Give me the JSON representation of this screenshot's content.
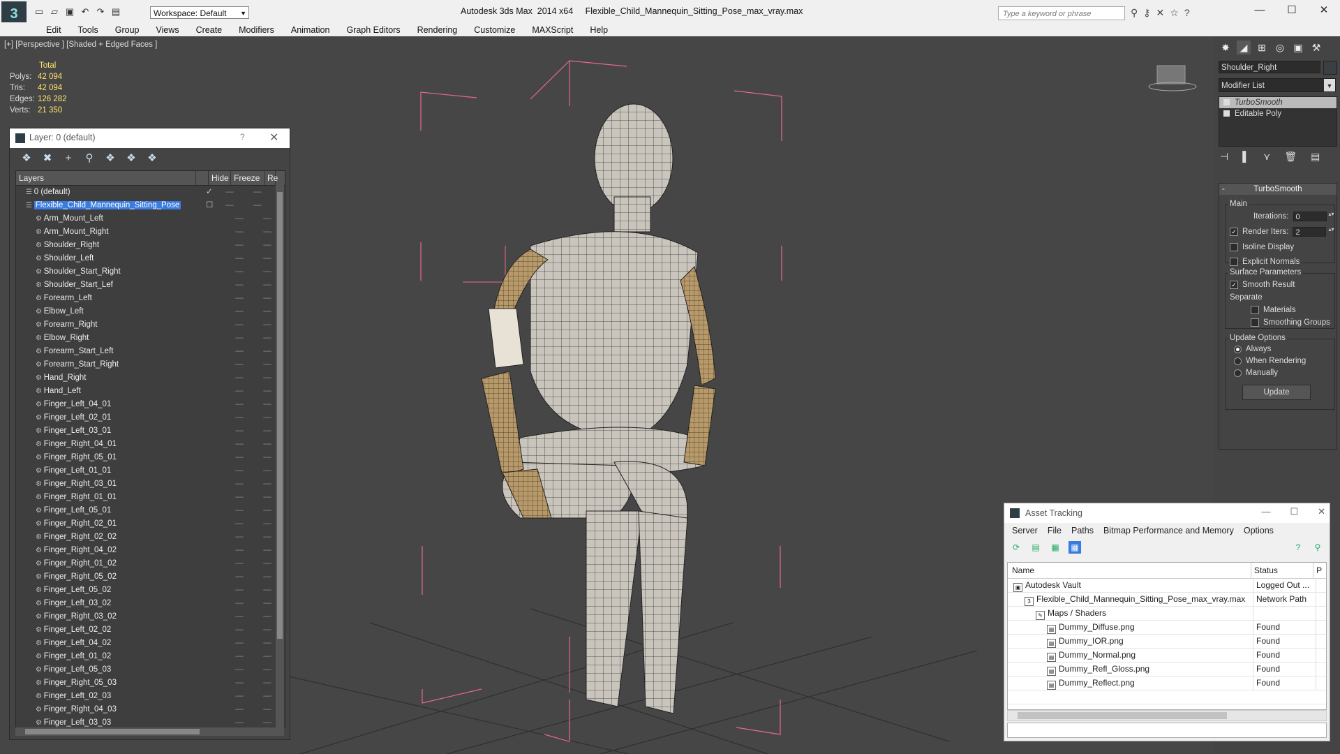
{
  "titlebar": {
    "app_title": "Autodesk 3ds Max  2014 x64     Flexible_Child_Mannequin_Sitting_Pose_max_vray.max",
    "workspace": "Workspace: Default",
    "search_placeholder": "Type a keyword or phrase"
  },
  "menu": [
    "Edit",
    "Tools",
    "Group",
    "Views",
    "Create",
    "Modifiers",
    "Animation",
    "Graph Editors",
    "Rendering",
    "Customize",
    "MAXScript",
    "Help"
  ],
  "viewport": {
    "label": "[+] [Perspective ] [Shaded + Edged Faces ]",
    "stats": {
      "header": "Total",
      "polys_label": "Polys:",
      "polys": "42 094",
      "tris_label": "Tris:",
      "tris": "42 094",
      "edges_label": "Edges:",
      "edges": "126 282",
      "verts_label": "Verts:",
      "verts": "21 350"
    }
  },
  "layer_dialog": {
    "title": "Layer: 0 (default)",
    "help": "?",
    "columns": {
      "layers": "Layers",
      "hide": "Hide",
      "freeze": "Freeze",
      "render": "Re"
    },
    "rows": [
      {
        "name": "0 (default)",
        "level": 0
      },
      {
        "name": "Flexible_Child_Mannequin_Sitting_Pose",
        "level": 0,
        "selected": true
      },
      {
        "name": "Arm_Mount_Left",
        "level": 1
      },
      {
        "name": "Arm_Mount_Right",
        "level": 1
      },
      {
        "name": "Shoulder_Right",
        "level": 1
      },
      {
        "name": "Shoulder_Left",
        "level": 1
      },
      {
        "name": "Shoulder_Start_Right",
        "level": 1
      },
      {
        "name": "Shoulder_Start_Lef",
        "level": 1
      },
      {
        "name": "Forearm_Left",
        "level": 1
      },
      {
        "name": "Elbow_Left",
        "level": 1
      },
      {
        "name": "Forearm_Right",
        "level": 1
      },
      {
        "name": "Elbow_Right",
        "level": 1
      },
      {
        "name": "Forearm_Start_Left",
        "level": 1
      },
      {
        "name": "Forearm_Start_Right",
        "level": 1
      },
      {
        "name": "Hand_Right",
        "level": 1
      },
      {
        "name": "Hand_Left",
        "level": 1
      },
      {
        "name": "Finger_Left_04_01",
        "level": 1
      },
      {
        "name": "Finger_Left_02_01",
        "level": 1
      },
      {
        "name": "Finger_Left_03_01",
        "level": 1
      },
      {
        "name": "Finger_Right_04_01",
        "level": 1
      },
      {
        "name": "Finger_Right_05_01",
        "level": 1
      },
      {
        "name": "Finger_Left_01_01",
        "level": 1
      },
      {
        "name": "Finger_Right_03_01",
        "level": 1
      },
      {
        "name": "Finger_Right_01_01",
        "level": 1
      },
      {
        "name": "Finger_Left_05_01",
        "level": 1
      },
      {
        "name": "Finger_Right_02_01",
        "level": 1
      },
      {
        "name": "Finger_Right_02_02",
        "level": 1
      },
      {
        "name": "Finger_Right_04_02",
        "level": 1
      },
      {
        "name": "Finger_Right_01_02",
        "level": 1
      },
      {
        "name": "Finger_Right_05_02",
        "level": 1
      },
      {
        "name": "Finger_Left_05_02",
        "level": 1
      },
      {
        "name": "Finger_Left_03_02",
        "level": 1
      },
      {
        "name": "Finger_Right_03_02",
        "level": 1
      },
      {
        "name": "Finger_Left_02_02",
        "level": 1
      },
      {
        "name": "Finger_Left_04_02",
        "level": 1
      },
      {
        "name": "Finger_Left_01_02",
        "level": 1
      },
      {
        "name": "Finger_Left_05_03",
        "level": 1
      },
      {
        "name": "Finger_Right_05_03",
        "level": 1
      },
      {
        "name": "Finger_Left_02_03",
        "level": 1
      },
      {
        "name": "Finger_Right_04_03",
        "level": 1
      },
      {
        "name": "Finger_Left_03_03",
        "level": 1
      }
    ]
  },
  "command_panel": {
    "object_name": "Shoulder_Right",
    "modifier_list": "Modifier List",
    "stack": [
      "TurboSmooth",
      "Editable Poly"
    ],
    "rollout_title": "TurboSmooth",
    "main_label": "Main",
    "iterations_label": "Iterations:",
    "iterations": "0",
    "render_iters_label": "Render Iters:",
    "render_iters": "2",
    "isoline": "Isoline Display",
    "explicit_normals": "Explicit Normals",
    "surface_params": "Surface Parameters",
    "smooth_result": "Smooth Result",
    "separate": "Separate",
    "materials": "Materials",
    "smoothing_groups": "Smoothing Groups",
    "update_options": "Update Options",
    "always": "Always",
    "when_rendering": "When Rendering",
    "manually": "Manually",
    "update_button": "Update"
  },
  "asset_tracking": {
    "title": "Asset Tracking",
    "menu": [
      "Server",
      "File",
      "Paths",
      "Bitmap Performance and Memory",
      "Options"
    ],
    "columns": {
      "name": "Name",
      "status": "Status",
      "extra": "P"
    },
    "rows": [
      {
        "name": "Autodesk Vault",
        "status": "Logged Out ...",
        "indent": 1
      },
      {
        "name": "Flexible_Child_Mannequin_Sitting_Pose_max_vray.max",
        "status": "Network Path",
        "indent": 2
      },
      {
        "name": "Maps / Shaders",
        "status": "",
        "indent": 3
      },
      {
        "name": "Dummy_Diffuse.png",
        "status": "Found",
        "indent": 4
      },
      {
        "name": "Dummy_IOR.png",
        "status": "Found",
        "indent": 4
      },
      {
        "name": "Dummy_Normal.png",
        "status": "Found",
        "indent": 4
      },
      {
        "name": "Dummy_Refl_Gloss.png",
        "status": "Found",
        "indent": 4
      },
      {
        "name": "Dummy_Reflect.png",
        "status": "Found",
        "indent": 4
      }
    ]
  },
  "colors": {
    "selection": "#3a7be0",
    "stats_value": "#ffe46a",
    "bbox": "#e86a8a"
  }
}
